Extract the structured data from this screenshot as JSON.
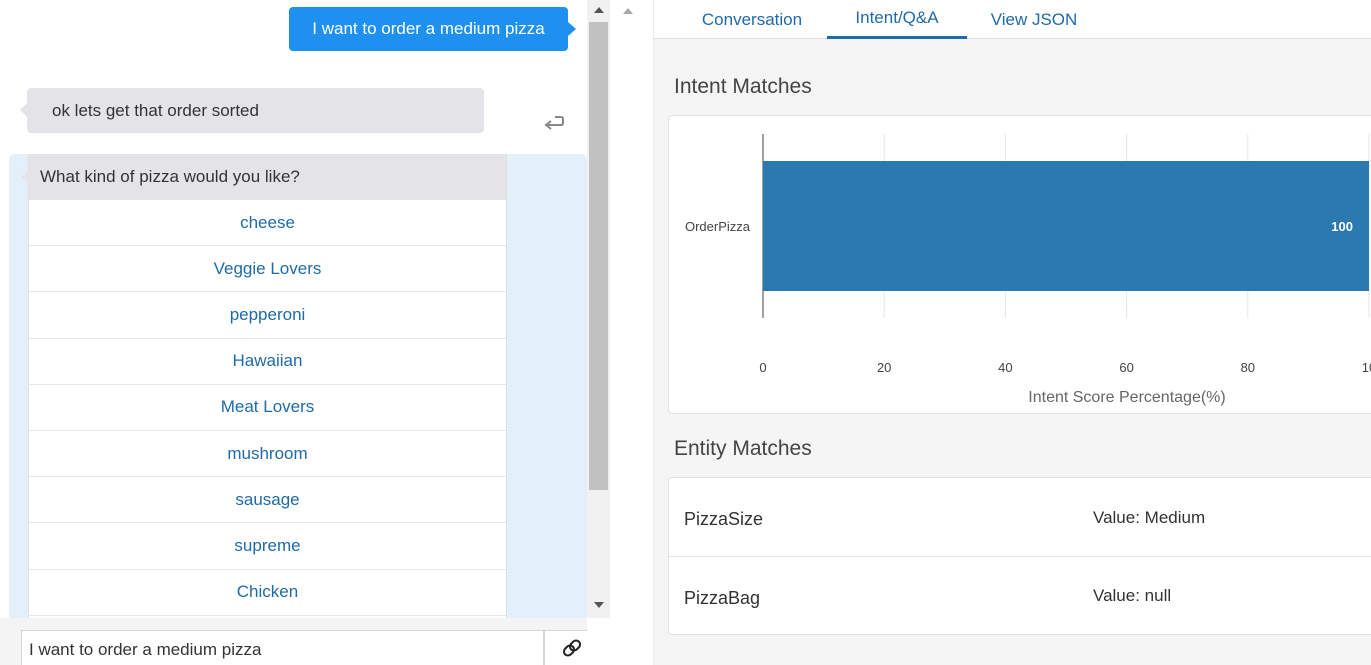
{
  "chat": {
    "user_message": "I want to order a medium pizza",
    "bot_message": "ok lets get that order sorted",
    "question": "What kind of pizza would you like?",
    "choices": [
      "cheese",
      "Veggie Lovers",
      "pepperoni",
      "Hawaiian",
      "Meat Lovers",
      "mushroom",
      "sausage",
      "supreme",
      "Chicken"
    ],
    "input_value": "I want to order a medium pizza"
  },
  "tabs": [
    {
      "label": "Conversation",
      "active": false
    },
    {
      "label": "Intent/Q&A",
      "active": true
    },
    {
      "label": "View JSON",
      "active": false
    }
  ],
  "intent_section": {
    "title": "Intent Matches"
  },
  "chart_data": {
    "type": "bar",
    "orientation": "horizontal",
    "categories": [
      "OrderPizza"
    ],
    "values": [
      100
    ],
    "data_labels": [
      "100"
    ],
    "xlabel": "Intent Score Percentage(%)",
    "ylabel": "",
    "xlim": [
      0,
      100
    ],
    "xticks": [
      "0",
      "20",
      "40",
      "60",
      "80",
      "10"
    ],
    "grid": true,
    "bar_color": "#2a7ab0"
  },
  "entity_section": {
    "title": "Entity Matches",
    "rows": [
      {
        "name": "PizzaSize",
        "value": "Value: Medium"
      },
      {
        "name": "PizzaBag",
        "value": "Value: null"
      }
    ]
  },
  "colors": {
    "accent": "#1e90f0",
    "link": "#1f6aa8",
    "bot_bubble": "#e4e3e8",
    "choice_bg": "#e3f0f9"
  },
  "icons": {
    "reply": "reply-arrow-icon",
    "attach": "link-icon",
    "scroll_up": "arrow-up-icon",
    "scroll_down": "arrow-down-icon"
  }
}
